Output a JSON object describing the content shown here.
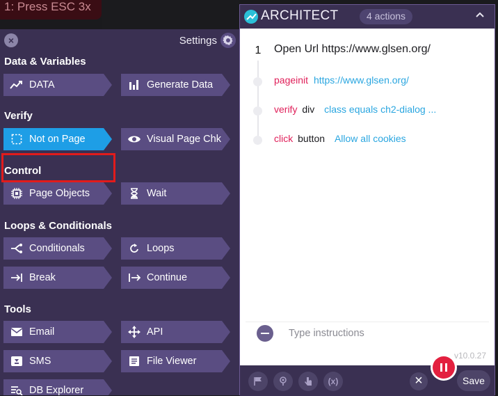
{
  "top_banner": {
    "text": "1: Press ESC 3x"
  },
  "left_panel": {
    "header": {
      "settings_label": "Settings"
    },
    "sections": {
      "data_variables": "Data & Variables",
      "verify": "Verify",
      "control": "Control",
      "loops_conditionals": "Loops & Conditionals",
      "tools": "Tools"
    },
    "buttons": {
      "data": "DATA",
      "generate_data": "Generate Data",
      "not_on_page": "Not on Page",
      "visual_page_chk": "Visual Page Chk",
      "page_objects": "Page Objects",
      "wait": "Wait",
      "conditionals": "Conditionals",
      "loops": "Loops",
      "break": "Break",
      "continue": "Continue",
      "email": "Email",
      "api": "API",
      "sms": "SMS",
      "file_viewer": "File Viewer",
      "db_explorer": "DB Explorer"
    },
    "highlighted_button": "not_on_page"
  },
  "right_panel": {
    "title": "ARCHITECT",
    "actions_count": "4 actions",
    "step": {
      "number": "1",
      "title": "Open Url https://www.glsen.org/",
      "actions": [
        {
          "keyword": "pageinit",
          "target": "",
          "detail": "https://www.glsen.org/"
        },
        {
          "keyword": "verify",
          "target": "div",
          "detail": "class equals ch2-dialog ..."
        },
        {
          "keyword": "click",
          "target": "button",
          "detail": "Allow all cookies"
        }
      ]
    },
    "instructions_placeholder": "Type instructions",
    "version": "v10.0.27",
    "footer": {
      "fx_label": "(x)",
      "save_label": "Save"
    }
  },
  "colors": {
    "panel_bg": "#3a3052",
    "button_bg": "#5a4d82",
    "active_button": "#1e9ee6",
    "highlight_border": "#e21b1b",
    "keyword": "#e0205a",
    "link": "#2aa6e0",
    "record_pause": "#e3203f"
  }
}
